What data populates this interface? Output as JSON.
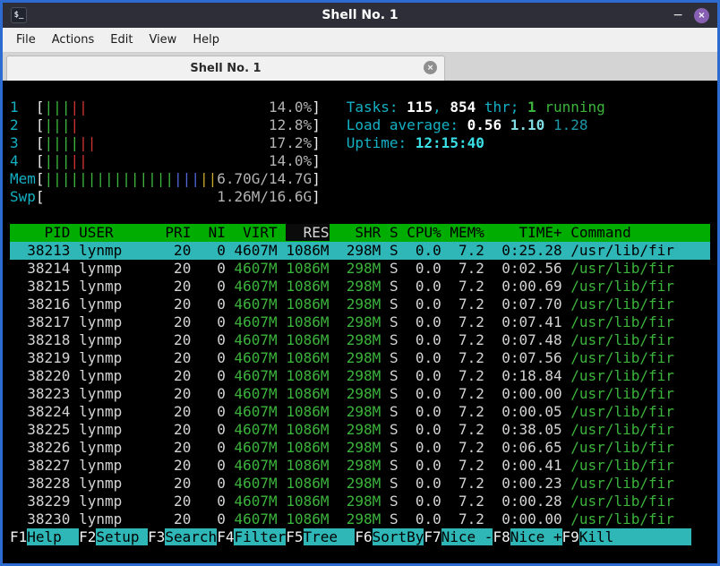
{
  "palette": {
    "window_border": "#2e6bd0",
    "titlebar_bg": "#2e2e38",
    "close_button": "#8760b3",
    "terminal_bg": "#000000",
    "green": "#3cb43c",
    "red": "#cc3333",
    "cyan_label": "#14b1c4",
    "bright_cyan": "#3ae0e6",
    "header_green_bg": "#00ad00",
    "selection_cyan_bg": "#2fb7b7"
  },
  "window": {
    "title": "Shell No. 1",
    "icon_glyph": "$_",
    "minimize_glyph": "−",
    "close_glyph": "×"
  },
  "menubar": {
    "items": [
      "File",
      "Actions",
      "Edit",
      "View",
      "Help"
    ]
  },
  "tab": {
    "title": "Shell No. 1",
    "close_glyph": "×"
  },
  "htop": {
    "meters": [
      {
        "id": "cpu-1",
        "label": "1",
        "inner_width": 31,
        "segments": [
          {
            "color": "green",
            "count": 3
          },
          {
            "color": "red",
            "count": 2
          }
        ],
        "value_text": "14.0%"
      },
      {
        "id": "cpu-2",
        "label": "2",
        "inner_width": 31,
        "segments": [
          {
            "color": "green",
            "count": 3
          },
          {
            "color": "red",
            "count": 1
          }
        ],
        "value_text": "12.8%"
      },
      {
        "id": "cpu-3",
        "label": "3",
        "inner_width": 31,
        "segments": [
          {
            "color": "green",
            "count": 4
          },
          {
            "color": "red",
            "count": 2
          }
        ],
        "value_text": "17.2%"
      },
      {
        "id": "cpu-4",
        "label": "4",
        "inner_width": 31,
        "segments": [
          {
            "color": "green",
            "count": 3
          },
          {
            "color": "red",
            "count": 2
          }
        ],
        "value_text": "14.0%"
      },
      {
        "id": "memory",
        "label": "Mem",
        "inner_width": 31,
        "segments": [
          {
            "color": "green",
            "count": 15
          },
          {
            "color": "blue",
            "count": 3
          },
          {
            "color": "yellow",
            "count": 2
          }
        ],
        "value_text": "6.70G/14.7G"
      },
      {
        "id": "swap",
        "label": "Swp",
        "inner_width": 31,
        "segments": [],
        "value_text": "1.26M/16.6G"
      }
    ],
    "summary": {
      "tasks_label": "Tasks: ",
      "tasks_count": "115",
      "tasks_sep": ", ",
      "threads_count": "854",
      "threads_label": " thr; ",
      "running_count": "1",
      "running_label": " running",
      "load_label": "Load average: ",
      "load_1": "0.56",
      "load_5": "1.10",
      "load_15": "1.28",
      "uptime_label": "Uptime: ",
      "uptime_value": "12:15:40"
    },
    "table": {
      "columns": [
        "PID",
        "USER",
        "PRI",
        "NI",
        "VIRT",
        "RES",
        "SHR",
        "S",
        "CPU%",
        "MEM%",
        "TIME+",
        "Command"
      ],
      "sort_column": "RES",
      "rows": [
        {
          "pid": "38213",
          "user": "lynmp",
          "pri": "20",
          "ni": "0",
          "virt": "4607M",
          "res": "1086M",
          "shr": "298M",
          "s": "S",
          "cpu": "0.0",
          "mem": "7.2",
          "time": "0:25.28",
          "command": "/usr/lib/fir",
          "selected": true
        },
        {
          "pid": "38214",
          "user": "lynmp",
          "pri": "20",
          "ni": "0",
          "virt": "4607M",
          "res": "1086M",
          "shr": "298M",
          "s": "S",
          "cpu": "0.0",
          "mem": "7.2",
          "time": "0:02.56",
          "command": "/usr/lib/fir",
          "selected": false
        },
        {
          "pid": "38215",
          "user": "lynmp",
          "pri": "20",
          "ni": "0",
          "virt": "4607M",
          "res": "1086M",
          "shr": "298M",
          "s": "S",
          "cpu": "0.0",
          "mem": "7.2",
          "time": "0:00.69",
          "command": "/usr/lib/fir",
          "selected": false
        },
        {
          "pid": "38216",
          "user": "lynmp",
          "pri": "20",
          "ni": "0",
          "virt": "4607M",
          "res": "1086M",
          "shr": "298M",
          "s": "S",
          "cpu": "0.0",
          "mem": "7.2",
          "time": "0:07.70",
          "command": "/usr/lib/fir",
          "selected": false
        },
        {
          "pid": "38217",
          "user": "lynmp",
          "pri": "20",
          "ni": "0",
          "virt": "4607M",
          "res": "1086M",
          "shr": "298M",
          "s": "S",
          "cpu": "0.0",
          "mem": "7.2",
          "time": "0:07.41",
          "command": "/usr/lib/fir",
          "selected": false
        },
        {
          "pid": "38218",
          "user": "lynmp",
          "pri": "20",
          "ni": "0",
          "virt": "4607M",
          "res": "1086M",
          "shr": "298M",
          "s": "S",
          "cpu": "0.0",
          "mem": "7.2",
          "time": "0:07.48",
          "command": "/usr/lib/fir",
          "selected": false
        },
        {
          "pid": "38219",
          "user": "lynmp",
          "pri": "20",
          "ni": "0",
          "virt": "4607M",
          "res": "1086M",
          "shr": "298M",
          "s": "S",
          "cpu": "0.0",
          "mem": "7.2",
          "time": "0:07.56",
          "command": "/usr/lib/fir",
          "selected": false
        },
        {
          "pid": "38220",
          "user": "lynmp",
          "pri": "20",
          "ni": "0",
          "virt": "4607M",
          "res": "1086M",
          "shr": "298M",
          "s": "S",
          "cpu": "0.0",
          "mem": "7.2",
          "time": "0:18.84",
          "command": "/usr/lib/fir",
          "selected": false
        },
        {
          "pid": "38223",
          "user": "lynmp",
          "pri": "20",
          "ni": "0",
          "virt": "4607M",
          "res": "1086M",
          "shr": "298M",
          "s": "S",
          "cpu": "0.0",
          "mem": "7.2",
          "time": "0:00.00",
          "command": "/usr/lib/fir",
          "selected": false
        },
        {
          "pid": "38224",
          "user": "lynmp",
          "pri": "20",
          "ni": "0",
          "virt": "4607M",
          "res": "1086M",
          "shr": "298M",
          "s": "S",
          "cpu": "0.0",
          "mem": "7.2",
          "time": "0:00.05",
          "command": "/usr/lib/fir",
          "selected": false
        },
        {
          "pid": "38225",
          "user": "lynmp",
          "pri": "20",
          "ni": "0",
          "virt": "4607M",
          "res": "1086M",
          "shr": "298M",
          "s": "S",
          "cpu": "0.0",
          "mem": "7.2",
          "time": "0:38.05",
          "command": "/usr/lib/fir",
          "selected": false
        },
        {
          "pid": "38226",
          "user": "lynmp",
          "pri": "20",
          "ni": "0",
          "virt": "4607M",
          "res": "1086M",
          "shr": "298M",
          "s": "S",
          "cpu": "0.0",
          "mem": "7.2",
          "time": "0:06.65",
          "command": "/usr/lib/fir",
          "selected": false
        },
        {
          "pid": "38227",
          "user": "lynmp",
          "pri": "20",
          "ni": "0",
          "virt": "4607M",
          "res": "1086M",
          "shr": "298M",
          "s": "S",
          "cpu": "0.0",
          "mem": "7.2",
          "time": "0:00.41",
          "command": "/usr/lib/fir",
          "selected": false
        },
        {
          "pid": "38228",
          "user": "lynmp",
          "pri": "20",
          "ni": "0",
          "virt": "4607M",
          "res": "1086M",
          "shr": "298M",
          "s": "S",
          "cpu": "0.0",
          "mem": "7.2",
          "time": "0:00.23",
          "command": "/usr/lib/fir",
          "selected": false
        },
        {
          "pid": "38229",
          "user": "lynmp",
          "pri": "20",
          "ni": "0",
          "virt": "4607M",
          "res": "1086M",
          "shr": "298M",
          "s": "S",
          "cpu": "0.0",
          "mem": "7.2",
          "time": "0:00.28",
          "command": "/usr/lib/fir",
          "selected": false
        },
        {
          "pid": "38230",
          "user": "lynmp",
          "pri": "20",
          "ni": "0",
          "virt": "4607M",
          "res": "1086M",
          "shr": "298M",
          "s": "S",
          "cpu": "0.0",
          "mem": "7.2",
          "time": "0:00.00",
          "command": "/usr/lib/fir",
          "selected": false
        }
      ]
    },
    "fn_keys": [
      {
        "key": "F1",
        "label": "Help"
      },
      {
        "key": "F2",
        "label": "Setup"
      },
      {
        "key": "F3",
        "label": "Search"
      },
      {
        "key": "F4",
        "label": "Filter"
      },
      {
        "key": "F5",
        "label": "Tree"
      },
      {
        "key": "F6",
        "label": "SortBy"
      },
      {
        "key": "F7",
        "label": "Nice -"
      },
      {
        "key": "F8",
        "label": "Nice +"
      },
      {
        "key": "F9",
        "label": "Kill"
      }
    ]
  }
}
